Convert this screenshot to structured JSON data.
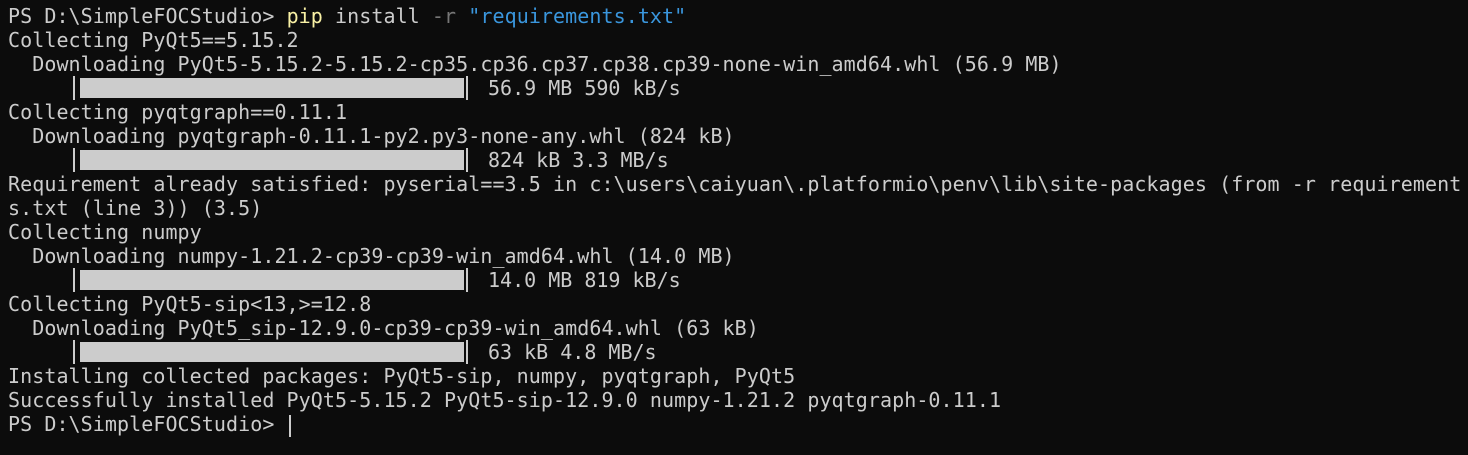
{
  "terminal": {
    "prompt_1": "PS D:\\SimpleFOCStudio> ",
    "command": {
      "name": "pip",
      "args": " install ",
      "flag": "-r",
      "space": " ",
      "file": "\"requirements.txt\""
    },
    "lines": {
      "l1": "Collecting PyQt5==5.15.2",
      "l2": "  Downloading PyQt5-5.15.2-5.15.2-cp35.cp36.cp37.cp38.cp39-none-win_amd64.whl (56.9 MB)",
      "l3_stats": "56.9 MB 590 kB/s",
      "l4": "Collecting pyqtgraph==0.11.1",
      "l5": "  Downloading pyqtgraph-0.11.1-py2.py3-none-any.whl (824 kB)",
      "l6_stats": "824 kB 3.3 MB/s",
      "l7": "Requirement already satisfied: pyserial==3.5 in c:\\users\\caiyuan\\.platformio\\penv\\lib\\site-packages (from -r requirement",
      "l8": "s.txt (line 3)) (3.5)",
      "l9": "Collecting numpy",
      "l10": "  Downloading numpy-1.21.2-cp39-cp39-win_amd64.whl (14.0 MB)",
      "l11_stats": "14.0 MB 819 kB/s",
      "l12": "Collecting PyQt5-sip<13,>=12.8",
      "l13": "  Downloading PyQt5_sip-12.9.0-cp39-cp39-win_amd64.whl (63 kB)",
      "l14_stats": "63 kB 4.8 MB/s",
      "l15": "Installing collected packages: PyQt5-sip, numpy, pyqtgraph, PyQt5",
      "l16": "Successfully installed PyQt5-5.15.2 PyQt5-sip-12.9.0 numpy-1.21.2 pyqtgraph-0.11.1"
    },
    "prompt_2": "PS D:\\SimpleFOCStudio> ",
    "progress": [
      1.0,
      1.0,
      1.0,
      1.0
    ]
  },
  "colors": {
    "background": "#0c0c0c",
    "foreground": "#cccccc",
    "command_name": "#f9f1a5",
    "flag": "#767676",
    "string": "#3a96dd"
  }
}
